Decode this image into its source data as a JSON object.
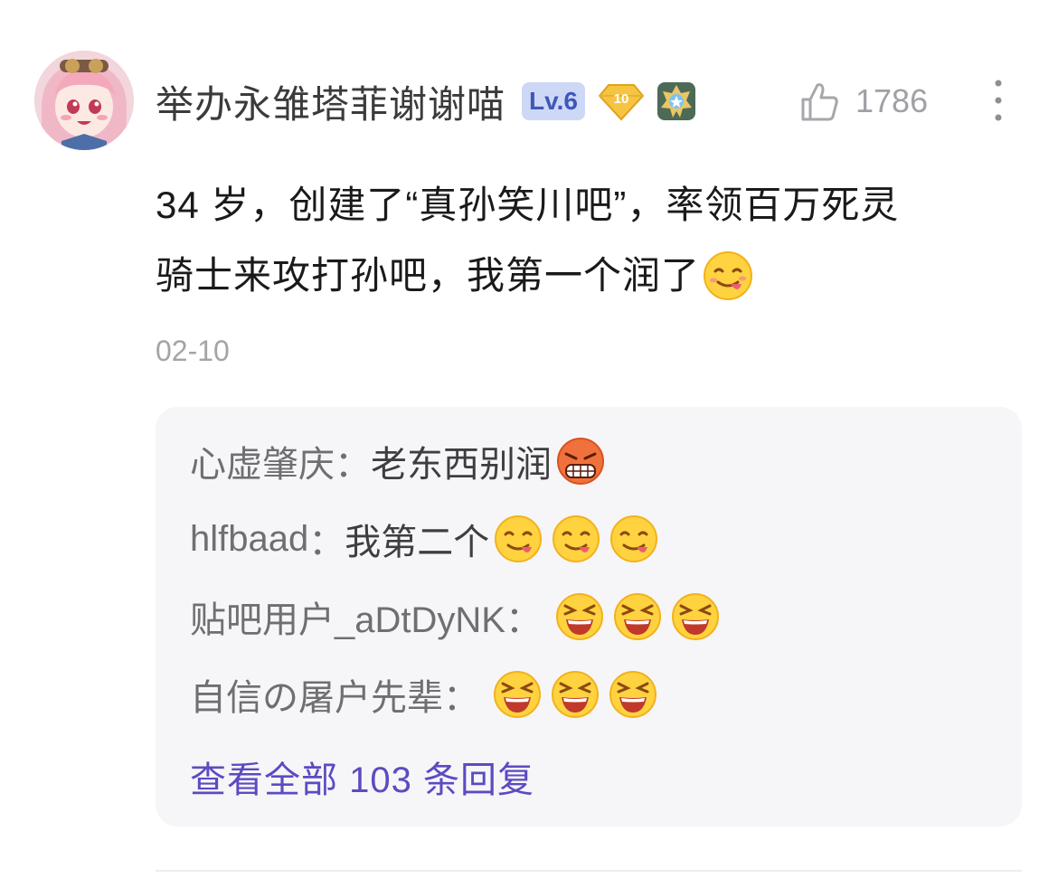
{
  "comment": {
    "username": "举办永雏塔菲谢谢喵",
    "level_badge": "Lv.6",
    "diamond_badge": "10",
    "like_icon": "thumb-up-icon",
    "likes": "1786",
    "more_icon": "vertical-dots-icon",
    "text_line1": "34 岁，创建了“真孙笑川吧”，率领百万死灵",
    "text_line2": "骑士来攻打孙吧，我第一个润了",
    "date": "02-10"
  },
  "replies": [
    {
      "user": "心虚肇庆",
      "sep": "：",
      "text": "老东西别润",
      "emoji": "angry-face-icon"
    },
    {
      "user": "hlfbaad",
      "sep": "：",
      "text": "我第二个",
      "emoji": "yum-face-icon"
    },
    {
      "user": "贴吧用户_aDtDyNK",
      "sep": "：",
      "text": "",
      "emoji": "laughing-face-icon"
    },
    {
      "user": "自信の屠户先辈",
      "sep": "：",
      "text": "",
      "emoji": "laughing-face-icon"
    }
  ],
  "view_all": "查看全部 103 条回复",
  "colors": {
    "accent": "#5b4bc2",
    "level_bg": "#cdd8f6",
    "box_bg": "#f6f6f8"
  }
}
